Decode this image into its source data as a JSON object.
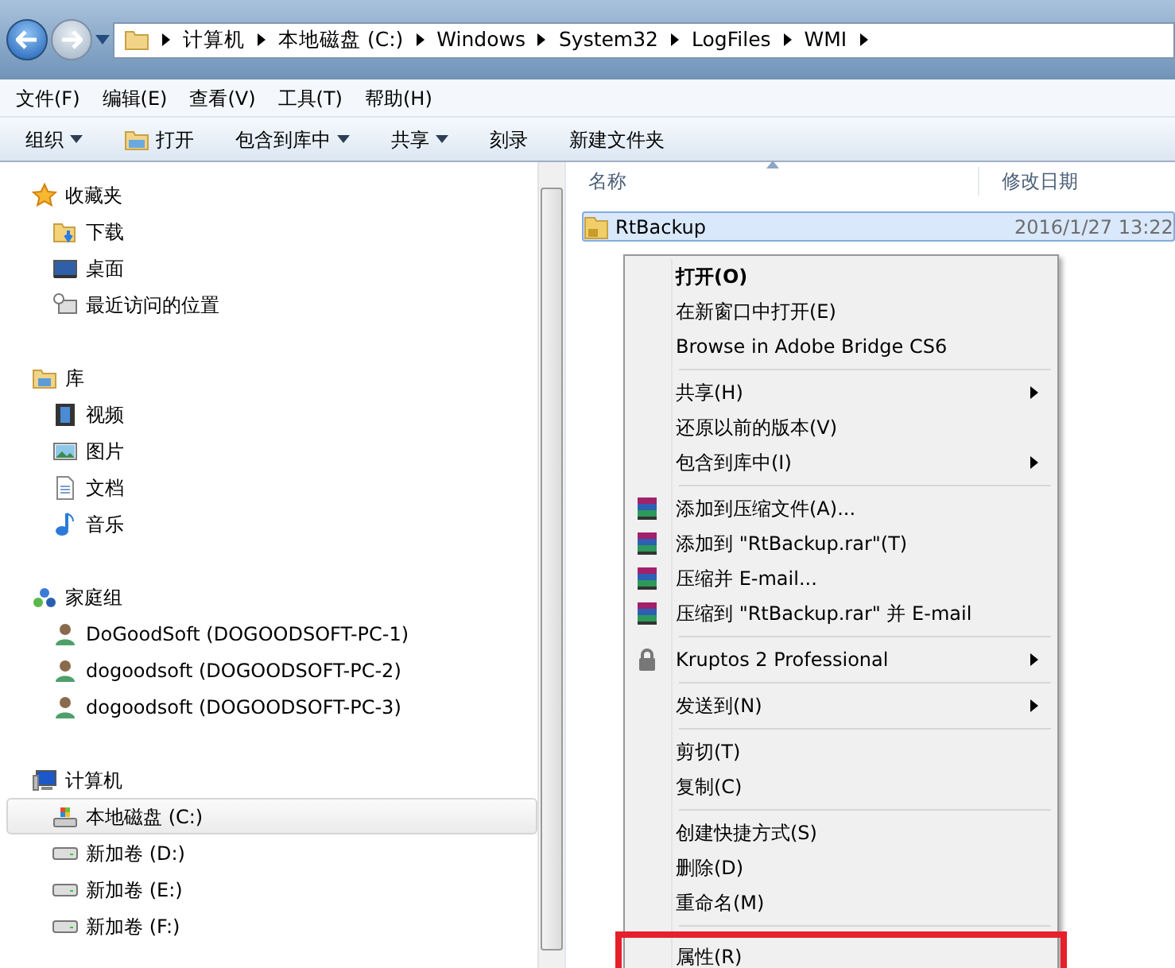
{
  "address_bar": {
    "breadcrumbs": [
      "计算机",
      "本地磁盘 (C:)",
      "Windows",
      "System32",
      "LogFiles",
      "WMI"
    ]
  },
  "menu_bar": [
    "文件(F)",
    "编辑(E)",
    "查看(V)",
    "工具(T)",
    "帮助(H)"
  ],
  "toolbar": [
    {
      "label": "组织",
      "dropdown": true,
      "kind": "plain"
    },
    {
      "label": "打开",
      "dropdown": false,
      "kind": "open"
    },
    {
      "label": "包含到库中",
      "dropdown": true,
      "kind": "plain"
    },
    {
      "label": "共享",
      "dropdown": true,
      "kind": "plain"
    },
    {
      "label": "刻录",
      "dropdown": false,
      "kind": "plain"
    },
    {
      "label": "新建文件夹",
      "dropdown": false,
      "kind": "plain"
    }
  ],
  "sidebar": {
    "groups": [
      {
        "label": "收藏夹",
        "children": [
          {
            "label": "下载",
            "selected": false
          },
          {
            "label": "桌面",
            "selected": false
          },
          {
            "label": "最近访问的位置",
            "selected": false
          }
        ]
      },
      {
        "label": "库",
        "children": [
          {
            "label": "视频",
            "selected": false
          },
          {
            "label": "图片",
            "selected": false
          },
          {
            "label": "文档",
            "selected": false
          },
          {
            "label": "音乐",
            "selected": false
          }
        ]
      },
      {
        "label": "家庭组",
        "children": [
          {
            "label": "DoGoodSoft (DOGOODSOFT-PC-1)",
            "selected": false
          },
          {
            "label": "dogoodsoft (DOGOODSOFT-PC-2)",
            "selected": false
          },
          {
            "label": "dogoodsoft (DOGOODSOFT-PC-3)",
            "selected": false
          }
        ]
      },
      {
        "label": "计算机",
        "children": [
          {
            "label": "本地磁盘 (C:)",
            "selected": true
          },
          {
            "label": "新加卷 (D:)",
            "selected": false
          },
          {
            "label": "新加卷 (E:)",
            "selected": false
          },
          {
            "label": "新加卷 (F:)",
            "selected": false
          }
        ]
      }
    ]
  },
  "file_list": {
    "columns": [
      {
        "label": "名称",
        "sorted": true
      },
      {
        "label": "修改日期",
        "sorted": false
      }
    ],
    "rows": [
      {
        "name": "RtBackup",
        "modified": "2016/1/27 13:22",
        "selected": true
      }
    ]
  },
  "context_menu": {
    "sections": [
      [
        {
          "label": "打开(O)",
          "default": true,
          "kind": "plain",
          "submenu": false,
          "highlighted": false
        },
        {
          "label": "在新窗口中打开(E)",
          "default": false,
          "kind": "plain",
          "submenu": false,
          "highlighted": false
        },
        {
          "label": "Browse in Adobe Bridge CS6",
          "default": false,
          "kind": "plain",
          "submenu": false,
          "highlighted": false
        }
      ],
      [
        {
          "label": "共享(H)",
          "default": false,
          "kind": "plain",
          "submenu": true,
          "highlighted": false
        },
        {
          "label": "还原以前的版本(V)",
          "default": false,
          "kind": "plain",
          "submenu": false,
          "highlighted": false
        },
        {
          "label": "包含到库中(I)",
          "default": false,
          "kind": "plain",
          "submenu": true,
          "highlighted": false
        }
      ],
      [
        {
          "label": "添加到压缩文件(A)...",
          "default": false,
          "kind": "archive",
          "submenu": false,
          "highlighted": false
        },
        {
          "label": "添加到 \"RtBackup.rar\"(T)",
          "default": false,
          "kind": "archive",
          "submenu": false,
          "highlighted": false
        },
        {
          "label": "压缩并 E-mail...",
          "default": false,
          "kind": "archive",
          "submenu": false,
          "highlighted": false
        },
        {
          "label": "压缩到 \"RtBackup.rar\" 并 E-mail",
          "default": false,
          "kind": "archive",
          "submenu": false,
          "highlighted": false
        }
      ],
      [
        {
          "label": "Kruptos 2 Professional",
          "default": false,
          "kind": "lock",
          "submenu": true,
          "highlighted": false
        }
      ],
      [
        {
          "label": "发送到(N)",
          "default": false,
          "kind": "plain",
          "submenu": true,
          "highlighted": false
        }
      ],
      [
        {
          "label": "剪切(T)",
          "default": false,
          "kind": "plain",
          "submenu": false,
          "highlighted": false
        },
        {
          "label": "复制(C)",
          "default": false,
          "kind": "plain",
          "submenu": false,
          "highlighted": false
        }
      ],
      [
        {
          "label": "创建快捷方式(S)",
          "default": false,
          "kind": "plain",
          "submenu": false,
          "highlighted": false
        },
        {
          "label": "删除(D)",
          "default": false,
          "kind": "plain",
          "submenu": false,
          "highlighted": false
        },
        {
          "label": "重命名(M)",
          "default": false,
          "kind": "plain",
          "submenu": false,
          "highlighted": false
        }
      ],
      [
        {
          "label": "属性(R)",
          "default": false,
          "kind": "plain",
          "submenu": false,
          "highlighted": true
        }
      ]
    ]
  }
}
